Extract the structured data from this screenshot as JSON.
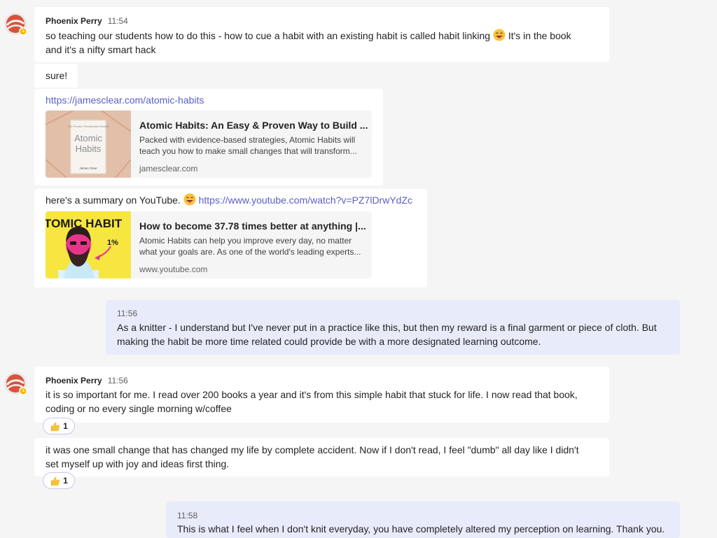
{
  "colors": {
    "page_bg": "#f5f5f5",
    "bubble_bg": "#ffffff",
    "my_bubble_bg": "#e8ebfa",
    "link": "#5b5fc7",
    "presence_away": "#f8b700"
  },
  "messages": [
    {
      "author": "Phoenix Perry",
      "time": "11:54",
      "avatar_icon": "swirl-avatar-icon",
      "text_parts": [
        "so teaching our students how to do this - how to cue a habit with an existing habit is called habit linking",
        "It's in the book",
        "and it's a nifty smart hack"
      ],
      "emoji": "grinning-tongue-emoji"
    },
    {
      "text": "sure!"
    },
    {
      "link": "https://jamesclear.com/atomic-habits",
      "card": {
        "title": "Atomic Habits: An Easy & Proven Way to Build ...",
        "description": "Packed with evidence-based strategies, Atomic Habits will teach you how to make small changes that will transform...",
        "domain": "jamesclear.com",
        "thumb": {
          "book_tag": "The Proven, Remarkable Results",
          "book_title_1": "Atomic",
          "book_title_2": "Habits",
          "book_author": "James Clear"
        }
      }
    },
    {
      "text": "here's a summary on YouTube.",
      "emoji": "grinning-tongue-emoji",
      "link": "https://www.youtube.com/watch?v=PZ7lDrwYdZc",
      "card": {
        "title": "How to become 37.78 times better at anything |...",
        "description": "Atomic Habits can help you improve every day, no matter what your goals are. As one of the world's leading experts...",
        "domain": "www.youtube.com",
        "thumb": {
          "banner": "TOMIC HABIT",
          "badge": "1%"
        }
      }
    },
    {
      "mine": true,
      "time": "11:56",
      "lines": [
        "As a knitter - I understand but I've never put in a practice like this, but then my reward is a final garment or piece of cloth. But",
        "making the habit be more time related could provide be with a more designated learning outcome."
      ]
    },
    {
      "author": "Phoenix Perry",
      "time": "11:56",
      "avatar_icon": "swirl-avatar-icon",
      "lines": [
        "it is so important for me. I read over 200 books a year and it's from this simple habit that stuck for life. I now read that book,",
        "coding or no every single morning w/coffee"
      ],
      "reaction": {
        "icon": "thumbs-up-icon",
        "count": "1"
      }
    },
    {
      "lines": [
        "it was one small change that has changed my life by complete accident. Now if I don't read, I feel \"dumb\" all day like I didn't",
        "set myself up with joy and ideas first thing."
      ],
      "reaction": {
        "icon": "thumbs-up-icon",
        "count": "1"
      }
    },
    {
      "mine": true,
      "time": "11:58",
      "lines": [
        "This is what I feel when I don't knit everyday, you have completely altered my perception on learning. Thank you."
      ]
    }
  ]
}
